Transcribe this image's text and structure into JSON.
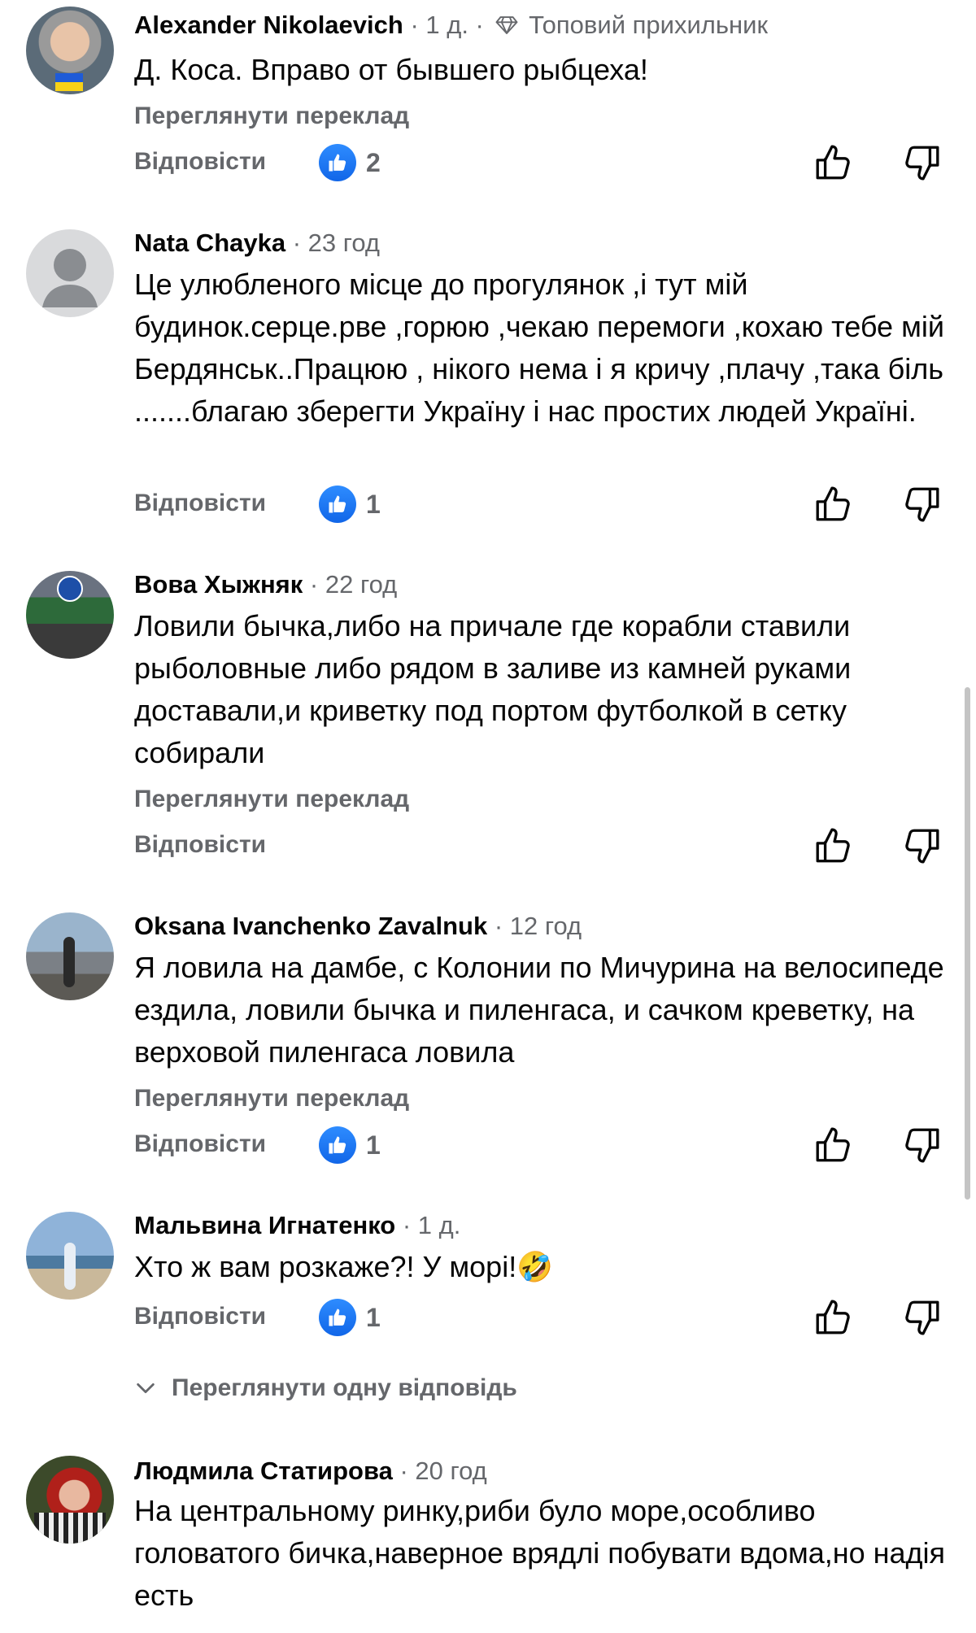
{
  "labels": {
    "see_translation": "Переглянути переклад",
    "reply": "Відповісти",
    "view_one_reply": "Переглянути одну відповідь"
  },
  "comments": [
    {
      "author": "Alexander Nikolaevich",
      "time": "· 1 д. ·",
      "badge": "Топовий прихильник",
      "text": "Д. Коса. Вправо от бывшего рыбцеха!",
      "likes": "2"
    },
    {
      "author": "Nata Chayka",
      "time": "· 23 год",
      "text": "Це улюбленого місце до прогулянок ,і тут мій будинок.серце.рве ,горюю ,чекаю перемоги ,кохаю тебе мій Бердянськ..Працюю , нікого нема і я кричу ,плачу ,така біль .......благаю зберегти Україну і нас простих людей Україні.",
      "likes": "1"
    },
    {
      "author": "Вова Хыжняк",
      "time": "· 22 год",
      "text": "Ловили бычка,либо на причале где корабли ставили рыболовные либо рядом в заливе из камней руками доставали,и криветку под портом футболкой в сетку собирали"
    },
    {
      "author": "Oksana Ivanchenko Zavalnuk",
      "time": "· 12 год",
      "text": "Я ловила на дамбе, с Колонии по Мичурина на велосипеде ездила, ловили бычка и пиленгаса, и сачком креветку, на верховой пиленгаса ловила",
      "likes": "1"
    },
    {
      "author": "Мальвина Игнатенко",
      "time": "· 1 д.",
      "text": "Хто ж вам розкаже?! У морі!",
      "emoji": "🤣",
      "likes": "1"
    },
    {
      "author": "Людмила Статирова",
      "time": "· 20 год",
      "text": "На  центральному ринку,риби було море,особливо головатого бичка,наверное врядлі побувати вдома,но надія есть"
    }
  ]
}
